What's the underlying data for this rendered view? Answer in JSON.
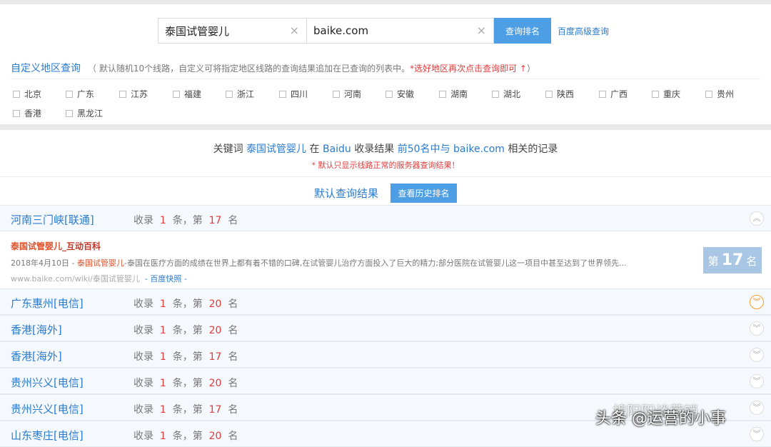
{
  "search": {
    "keyword": "泰国试管婴儿",
    "site": "baike.com",
    "clear_icon": "×",
    "query_button": "查询排名",
    "advanced_link": "百度高级查询"
  },
  "region": {
    "title": "自定义地区查询",
    "hint": "（ 默认随机10个线路，自定义可将指定地区线路的查询结果追加在已查询的列表中。",
    "tip": "*选好地区再次点击查询即可 ↑",
    "hint_end": "）",
    "cities": [
      "北京",
      "广东",
      "江苏",
      "福建",
      "浙江",
      "四川",
      "河南",
      "安徽",
      "湖南",
      "湖北",
      "陕西",
      "广西",
      "重庆",
      "贵州",
      "香港",
      "黑龙江"
    ]
  },
  "summary": {
    "prefix": "关键词",
    "keyword": "泰国试管婴儿",
    "mid1": "在",
    "engine": "Baidu",
    "mid2": "收录结果",
    "range": "前50名中与",
    "site": "baike.com",
    "suffix": "相关的记录",
    "note": "* 默认只显示线路正常的服务器查询结果！"
  },
  "default_section": {
    "title": "默认查询结果",
    "history_button": "查看历史排名"
  },
  "stat_labels": {
    "shoulu": "收录",
    "tiao": "条，第",
    "ming": "名"
  },
  "lines": [
    {
      "name": "河南三门峡[联通]",
      "count": "1",
      "rank": "17",
      "chevron": "︽"
    },
    {
      "name": "广东惠州[电信]",
      "count": "1",
      "rank": "20",
      "chevron": "︾"
    },
    {
      "name": "香港[海外]",
      "count": "1",
      "rank": "20",
      "chevron": "︾"
    },
    {
      "name": "香港[海外]",
      "count": "1",
      "rank": "17",
      "chevron": "︾"
    },
    {
      "name": "贵州兴义[电信]",
      "count": "1",
      "rank": "20",
      "chevron": "︾"
    },
    {
      "name": "贵州兴义[电信]",
      "count": "1",
      "rank": "17",
      "chevron": "︾"
    },
    {
      "name": "山东枣庄[电信]",
      "count": "1",
      "rank": "20",
      "chevron": "︾"
    }
  ],
  "result": {
    "title_hl": "泰国试管婴儿",
    "title_tail": "_互动百科",
    "date": "2018年4月10日 -",
    "snippet_hl": "泰国试管婴儿",
    "snippet": "-泰国在医疗方面的成绩在世界上都有着不错的口碑,在试管婴儿治疗方面投入了巨大的精力;部分医院在试管婴儿这一项目中甚至达到了世界领先...",
    "url": "www.baike.com/wiki/泰国试管婴儿",
    "snapshot": "- 百度快照 -",
    "badge_pre": "第",
    "badge_rank": "17",
    "badge_post": "名"
  },
  "watermark": {
    "line1": "棉阳阳谈营销",
    "line2": "头条 @运营的小事"
  }
}
